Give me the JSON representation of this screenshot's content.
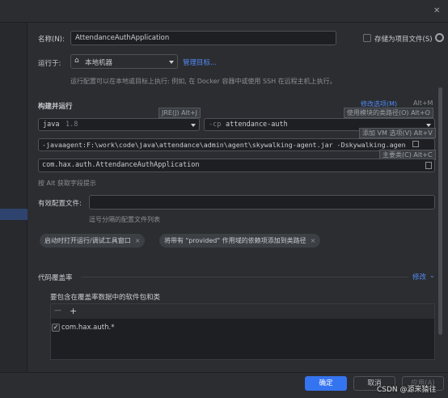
{
  "dialog": {
    "close_glyph": "✕"
  },
  "form": {
    "name_label": "名称(N):",
    "name_value": "AttendanceAuthApplication",
    "store_as_project_file": "存储为项目文件(S)",
    "run_on_label": "运行于:",
    "run_on_value": "本地机器",
    "manage_targets": "管理目标...",
    "run_on_hint": "运行配置可以在本地或目标上执行: 例如, 在 Docker 容器中或使用 SSH 在远程主机上执行。"
  },
  "build": {
    "section_title": "构建并运行",
    "modify_options": "修改选项(M)",
    "modify_shortcut": "Alt+M",
    "tip_jre": "JRE(J) Alt+J",
    "tip_classpath": "使用模块的类路径(O) Alt+O",
    "java_version": "java",
    "java_version_num": "1.8",
    "cp_prefix": "-cp",
    "cp_value": "attendance-auth",
    "vm_options": "-javaagent:F:\\work\\code\\java\\attendance\\admin\\agent\\skywalking-agent.jar -Dskywalking.agen",
    "tip_vm": "添加 VM 选项(V) Alt+V",
    "tip_main_class": "主要类(C) Alt+C",
    "main_class": "com.hax.auth.AttendanceAuthApplication",
    "alt_hint": "按 Alt 获取字段提示",
    "profiles_label": "有效配置文件:",
    "profiles_value": "",
    "profiles_hint": "逗号分隔的配置文件列表"
  },
  "chips": [
    {
      "label": "启动时打开运行/调试工具窗口"
    },
    {
      "label": "将带有 \"provided\" 作用域的依赖项添加到类路径"
    }
  ],
  "coverage": {
    "title": "代码覆盖率",
    "modify": "修改",
    "include_label": "要包含在覆盖率数据中的软件包和类",
    "remove_glyph": "—",
    "add_glyph": "+",
    "entries": [
      {
        "checked": true,
        "pattern": "com.hax.auth.*"
      }
    ]
  },
  "footer": {
    "ok": "确定",
    "cancel": "取消",
    "apply": "应用(A)"
  },
  "watermark": "CSDN @源来猿往",
  "colors": {
    "bg": "#2b2d30",
    "field_bg": "#1e1f22",
    "link": "#548af7",
    "primary_button": "#3574f0"
  }
}
